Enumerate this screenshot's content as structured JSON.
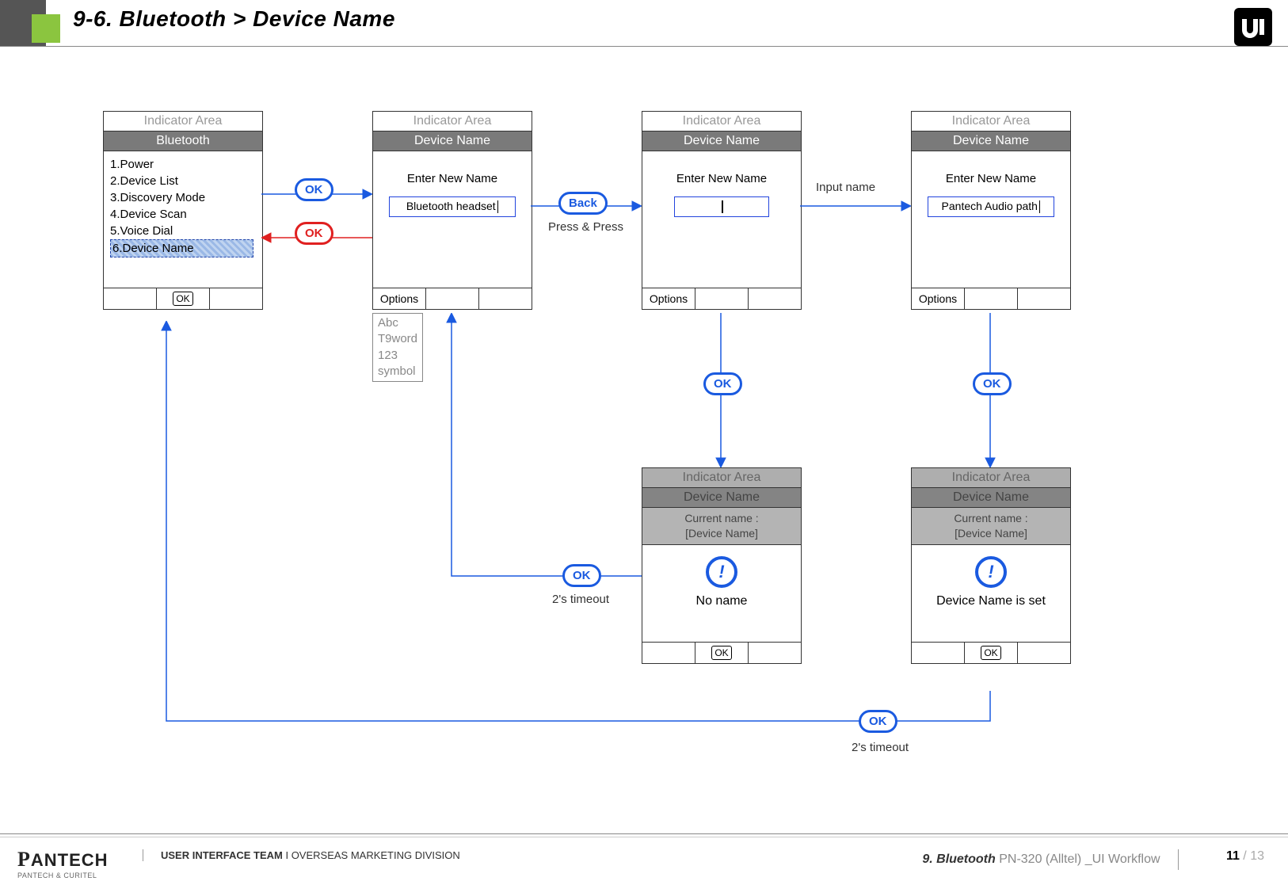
{
  "header": {
    "title": "9-6. Bluetooth > Device Name"
  },
  "screens": {
    "bluetooth": {
      "indicator": "Indicator Area",
      "title": "Bluetooth",
      "items": [
        "1.Power",
        "2.Device List",
        "3.Discovery Mode",
        "4.Device Scan",
        "5.Voice Dial",
        "6.Device Name"
      ],
      "softkeys": {
        "left": "",
        "center": "OK",
        "right": ""
      }
    },
    "name1": {
      "indicator": "Indicator Area",
      "title": "Device Name",
      "prompt": "Enter New Name",
      "value": "Bluetooth headset",
      "softkeys": {
        "left": "Options",
        "center": "",
        "right": ""
      },
      "options_popup": [
        "Abc",
        "T9word",
        "123",
        "symbol"
      ]
    },
    "name2": {
      "indicator": "Indicator Area",
      "title": "Device Name",
      "prompt": "Enter New Name",
      "value": "",
      "softkeys": {
        "left": "Options",
        "center": "",
        "right": ""
      }
    },
    "name3": {
      "indicator": "Indicator Area",
      "title": "Device Name",
      "prompt": "Enter New Name",
      "value": "Pantech Audio path",
      "softkeys": {
        "left": "Options",
        "center": "",
        "right": ""
      }
    },
    "popup_noname": {
      "indicator": "Indicator Area",
      "title": "Device Name",
      "dim_line1": "Current name :",
      "dim_line2": "[Device Name]",
      "message": "No name",
      "softkeys": {
        "left": "",
        "center": "OK",
        "right": ""
      }
    },
    "popup_set": {
      "indicator": "Indicator Area",
      "title": "Device Name",
      "dim_line1": "Current name :",
      "dim_line2": "[Device Name]",
      "message": "Device Name is set",
      "softkeys": {
        "left": "",
        "center": "OK",
        "right": ""
      }
    }
  },
  "transitions": {
    "t1": {
      "label": "OK"
    },
    "t_back_red": {
      "label": "OK"
    },
    "t2": {
      "label": "Back",
      "note": "Press & Press"
    },
    "t3": {
      "label": "Input name"
    },
    "t4": {
      "label": "OK"
    },
    "t5": {
      "label": "OK"
    },
    "t6": {
      "label": "OK",
      "note": "2's timeout"
    },
    "t7": {
      "label": "OK",
      "note": "2's timeout"
    }
  },
  "footer": {
    "brand": "PANTECH",
    "brand_sub": "PANTECH & CURITEL",
    "team_bold": "USER INTERFACE TEAM",
    "team_sep": "  I  ",
    "team_rest": "OVERSEAS MARKETING DIVISION",
    "section_bold": "9. Bluetooth",
    "section_rest": " PN-320 (Alltel) _UI Workflow",
    "page_current": "11",
    "page_total": " / 13"
  }
}
